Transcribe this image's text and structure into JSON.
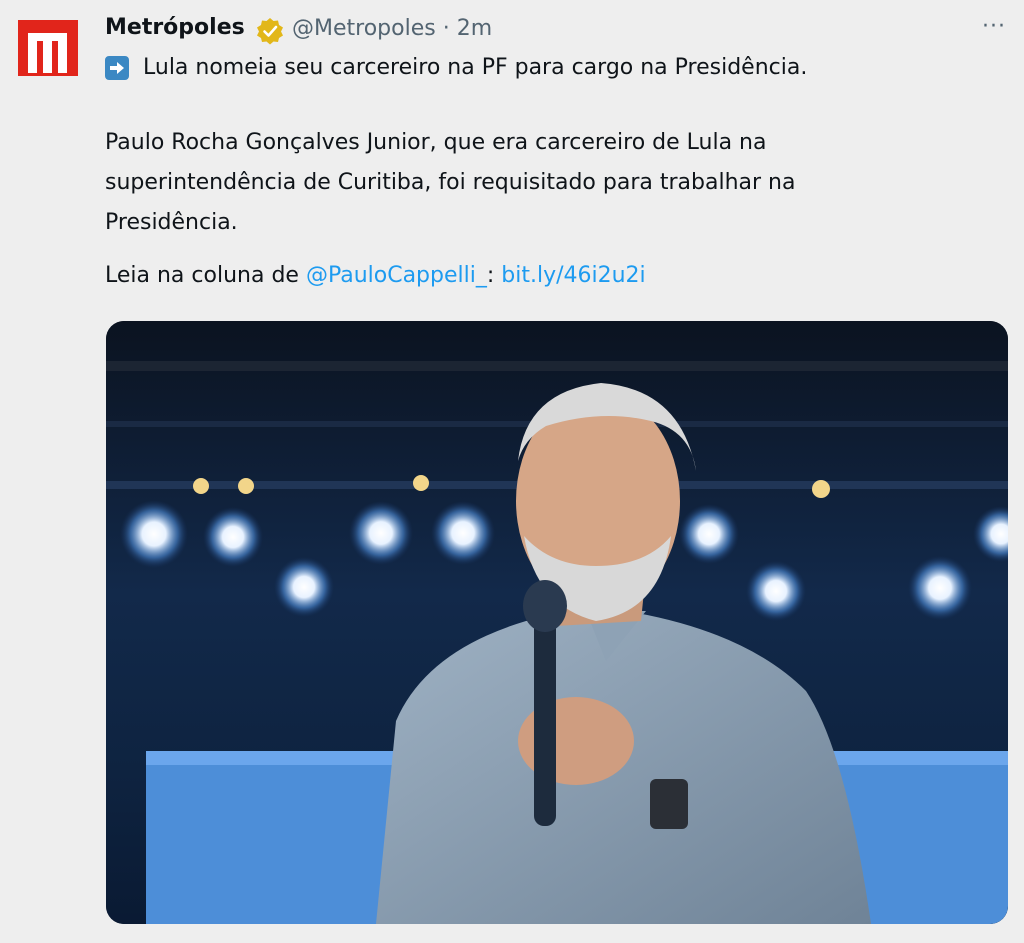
{
  "tweet": {
    "author_name": "Metrópoles",
    "handle": "@Metropoles",
    "separator": "·",
    "time": "2m",
    "more_label": "···",
    "headline": "Lula nomeia seu carcereiro na PF para cargo na Presidência.",
    "body_lines": [
      "Paulo Rocha Gonçalves Junior, que era carcereiro de Lula na",
      "superintendência de Curitiba, foi requisitado para trabalhar na",
      "Presidência."
    ],
    "read_prefix": "Leia na coluna de ",
    "mention": "@PauloCappelli_",
    "read_sep": ": ",
    "url": "bit.ly/46i2u2i"
  },
  "colors": {
    "brand_red": "#e1251b",
    "verified_gold": "#e2b719",
    "link_blue": "#1d9bf0",
    "muted": "#536471"
  },
  "icons": {
    "avatar": "metropoles-logo-icon",
    "verified": "verified-badge-icon",
    "arrow": "right-arrow-emoji-icon",
    "more": "more-options-icon"
  }
}
